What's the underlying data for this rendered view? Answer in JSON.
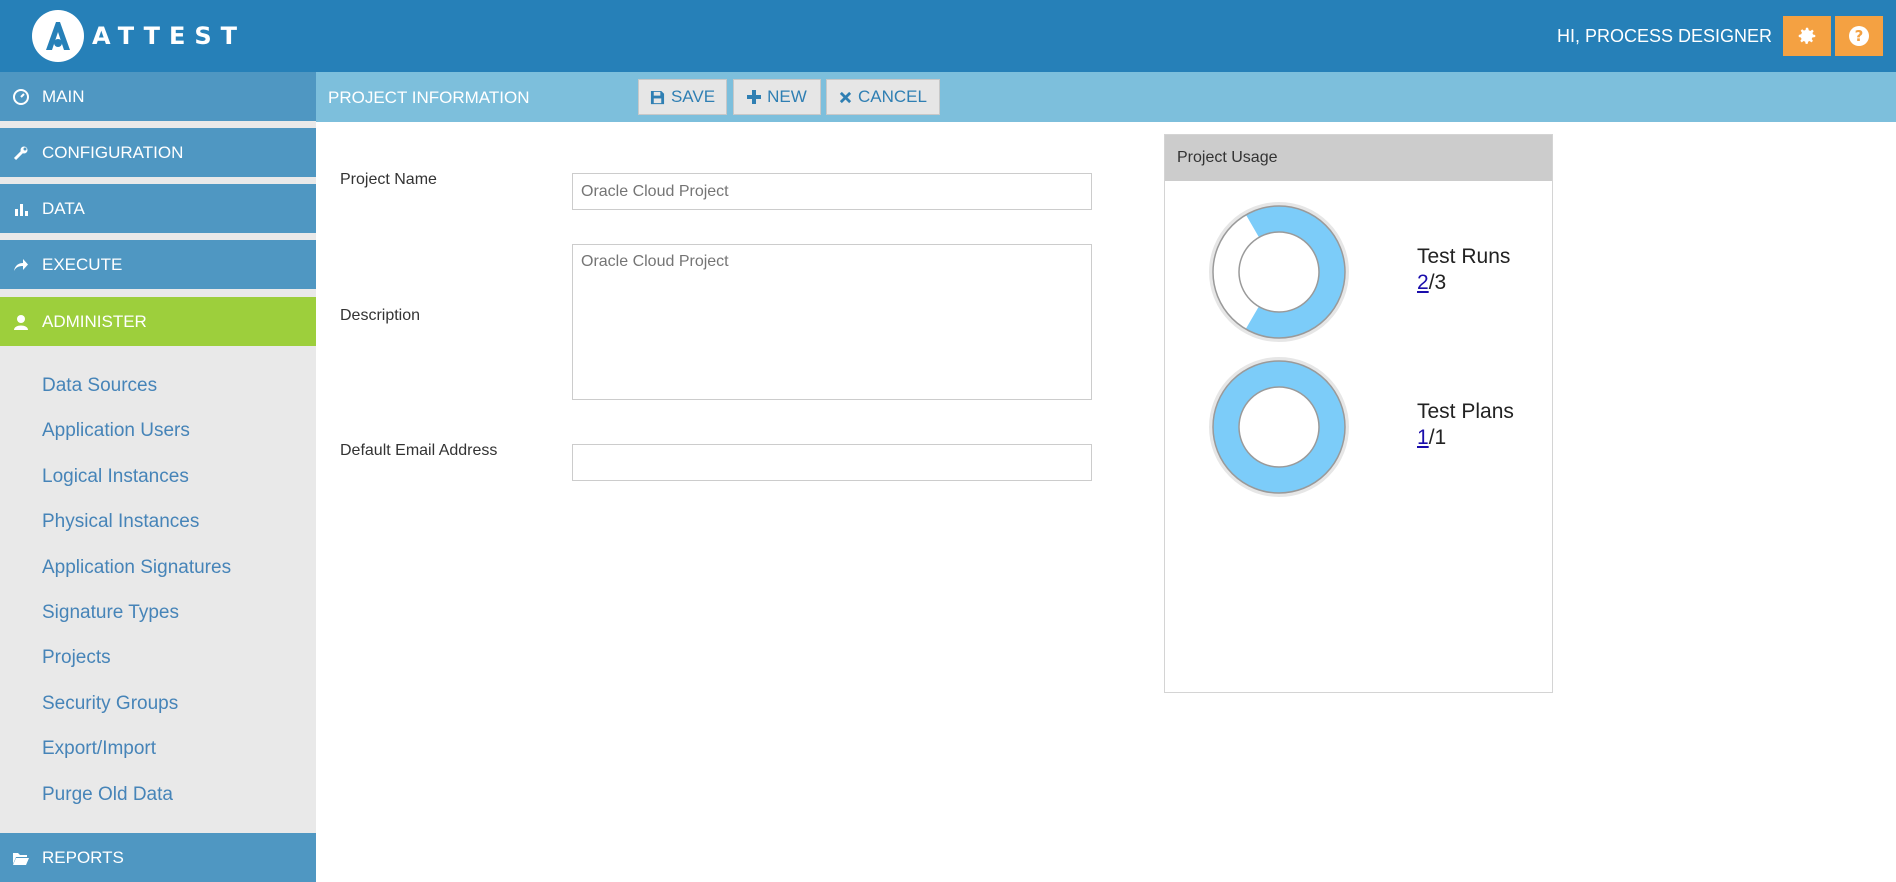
{
  "header": {
    "brand": "ATTEST",
    "greeting": "HI, PROCESS DESIGNER"
  },
  "sidebar": {
    "nav": [
      {
        "label": "MAIN",
        "icon": "dashboard-icon"
      },
      {
        "label": "CONFIGURATION",
        "icon": "wrench-icon"
      },
      {
        "label": "DATA",
        "icon": "bar-chart-icon"
      },
      {
        "label": "EXECUTE",
        "icon": "share-arrow-icon"
      },
      {
        "label": "ADMINISTER",
        "icon": "user-icon"
      },
      {
        "label": "REPORTS",
        "icon": "folder-open-icon"
      }
    ],
    "sub_items": [
      "Data Sources",
      "Application Users",
      "Logical Instances",
      "Physical Instances",
      "Application Signatures",
      "Signature Types",
      "Projects",
      "Security Groups",
      "Export/Import",
      "Purge Old Data"
    ]
  },
  "toolbar": {
    "title": "PROJECT INFORMATION",
    "save_label": "SAVE",
    "new_label": "NEW",
    "cancel_label": "CANCEL"
  },
  "form": {
    "project_name_label": "Project Name",
    "project_name_placeholder": "Oracle Cloud Project",
    "description_label": "Description",
    "description_placeholder": "Oracle Cloud Project",
    "email_label": "Default Email Address",
    "email_value": ""
  },
  "usage": {
    "title": "Project Usage",
    "test_runs": {
      "label": "Test Runs",
      "used": "2",
      "total": "/3",
      "fraction": 0.6667
    },
    "test_plans": {
      "label": "Test Plans",
      "used": "1",
      "total": "/1",
      "fraction": 1.0
    }
  },
  "colors": {
    "header": "#2680b8",
    "nav": "#4f97c2",
    "nav_active": "#9dcf3c",
    "accent_button": "#f4a142",
    "donut_fill": "#7cccf9"
  }
}
